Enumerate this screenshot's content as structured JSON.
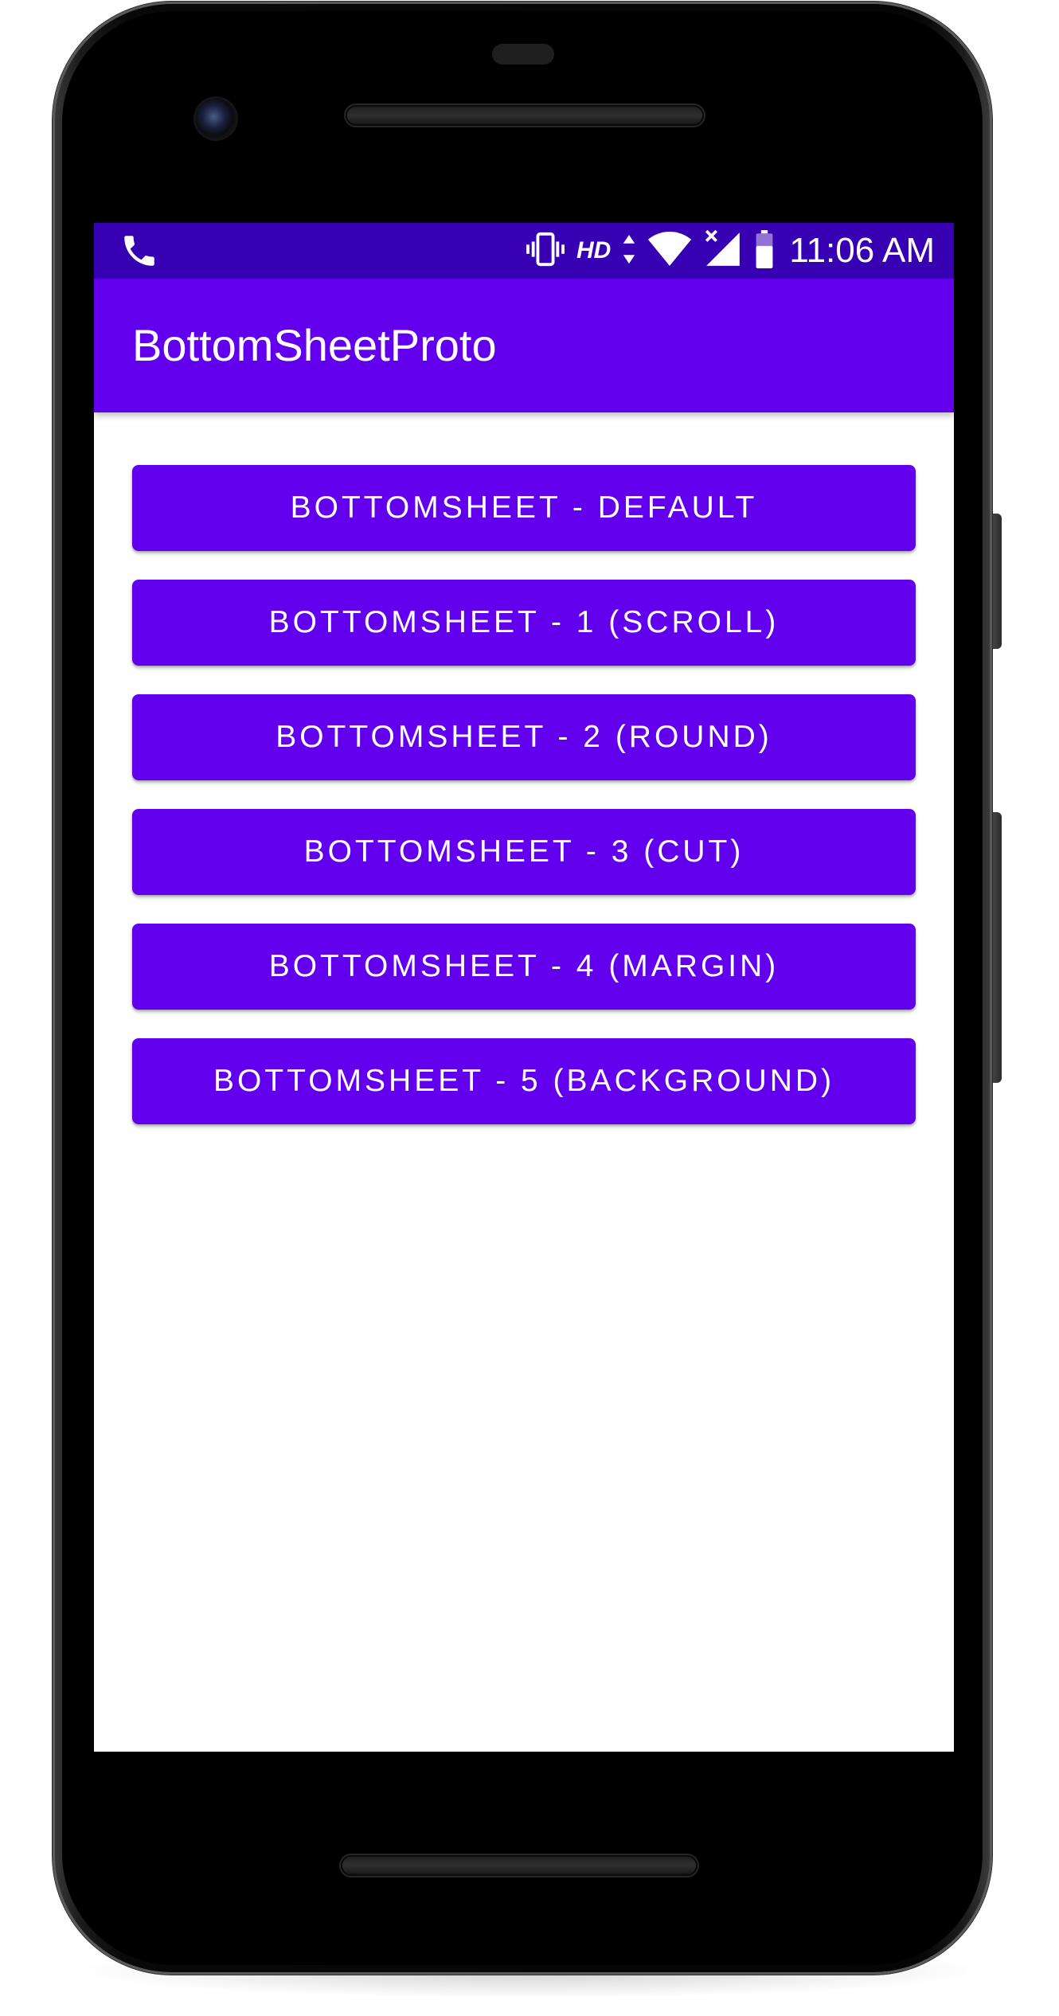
{
  "status_bar": {
    "time": "11:06 AM",
    "network_label": "HD",
    "icons": [
      "phone-icon",
      "vibrate-icon",
      "data-arrows-icon",
      "wifi-icon",
      "cell-signal-icon",
      "battery-icon"
    ]
  },
  "app_bar": {
    "title": "BottomSheetProto"
  },
  "buttons": [
    {
      "label": "BOTTOMSHEET - DEFAULT"
    },
    {
      "label": "BOTTOMSHEET - 1 (SCROLL)"
    },
    {
      "label": "BOTTOMSHEET - 2 (ROUND)"
    },
    {
      "label": "BOTTOMSHEET - 3 (CUT)"
    },
    {
      "label": "BOTTOMSHEET - 4 (MARGIN)"
    },
    {
      "label": "BOTTOMSHEET - 5 (BACKGROUND)"
    }
  ],
  "colors": {
    "primary": "#6200EE",
    "primary_dark": "#3700B3",
    "on_primary": "#FFFFFF",
    "background": "#FFFFFF"
  }
}
